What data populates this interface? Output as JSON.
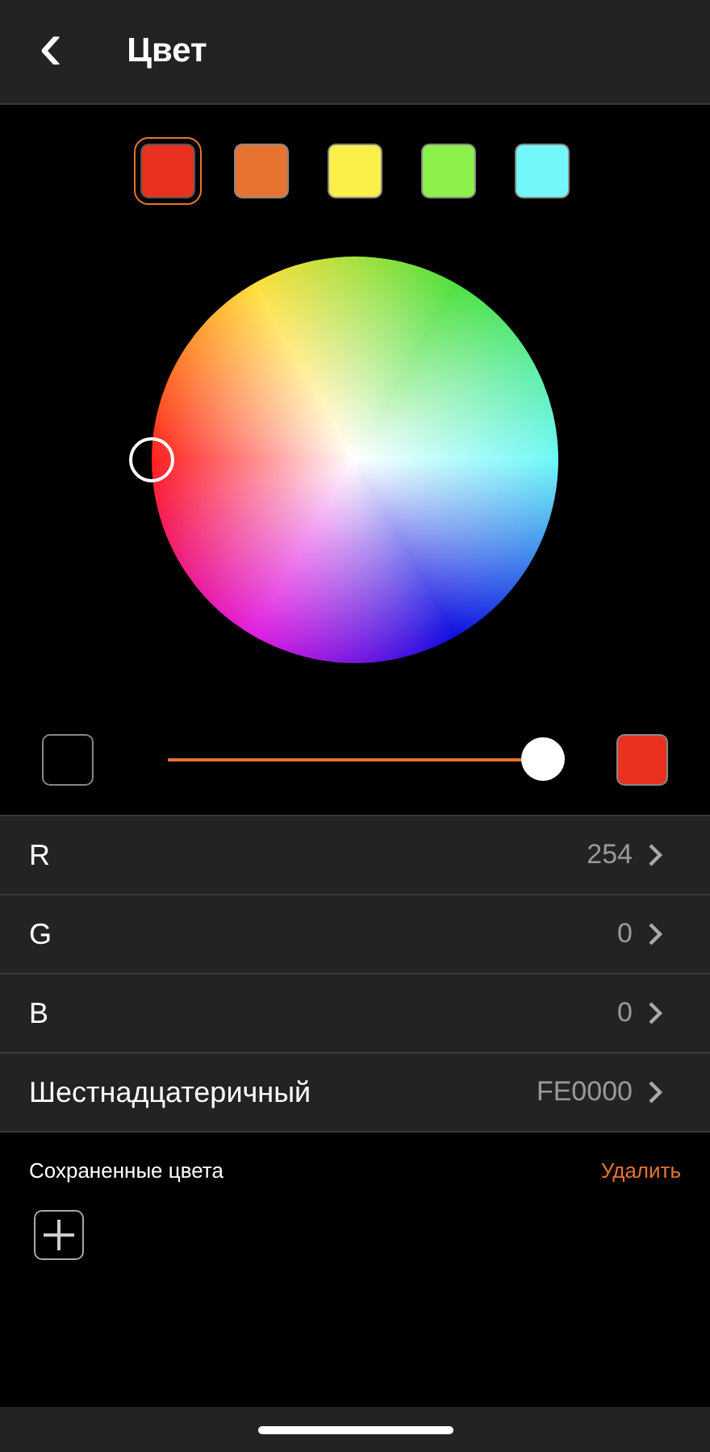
{
  "header": {
    "back": "‹",
    "title": "Цвет"
  },
  "presets": [
    {
      "color": "#e8321f",
      "selected": true
    },
    {
      "color": "#e67430",
      "selected": false
    },
    {
      "color": "#fbef4a",
      "selected": false
    },
    {
      "color": "#8cf04a",
      "selected": false
    },
    {
      "color": "#74f7fb",
      "selected": false
    }
  ],
  "brightness": {
    "ends": [
      {
        "color": "#000000"
      },
      {
        "color": "#e8321f"
      }
    ]
  },
  "values": [
    {
      "label": "R",
      "value": "254"
    },
    {
      "label": "G",
      "value": "0"
    },
    {
      "label": "B",
      "value": "0"
    },
    {
      "label": "Шестнадцатеричный",
      "value": "FE0000"
    }
  ],
  "saved": {
    "title": "Сохраненные цвета",
    "delete": "Удалить"
  }
}
